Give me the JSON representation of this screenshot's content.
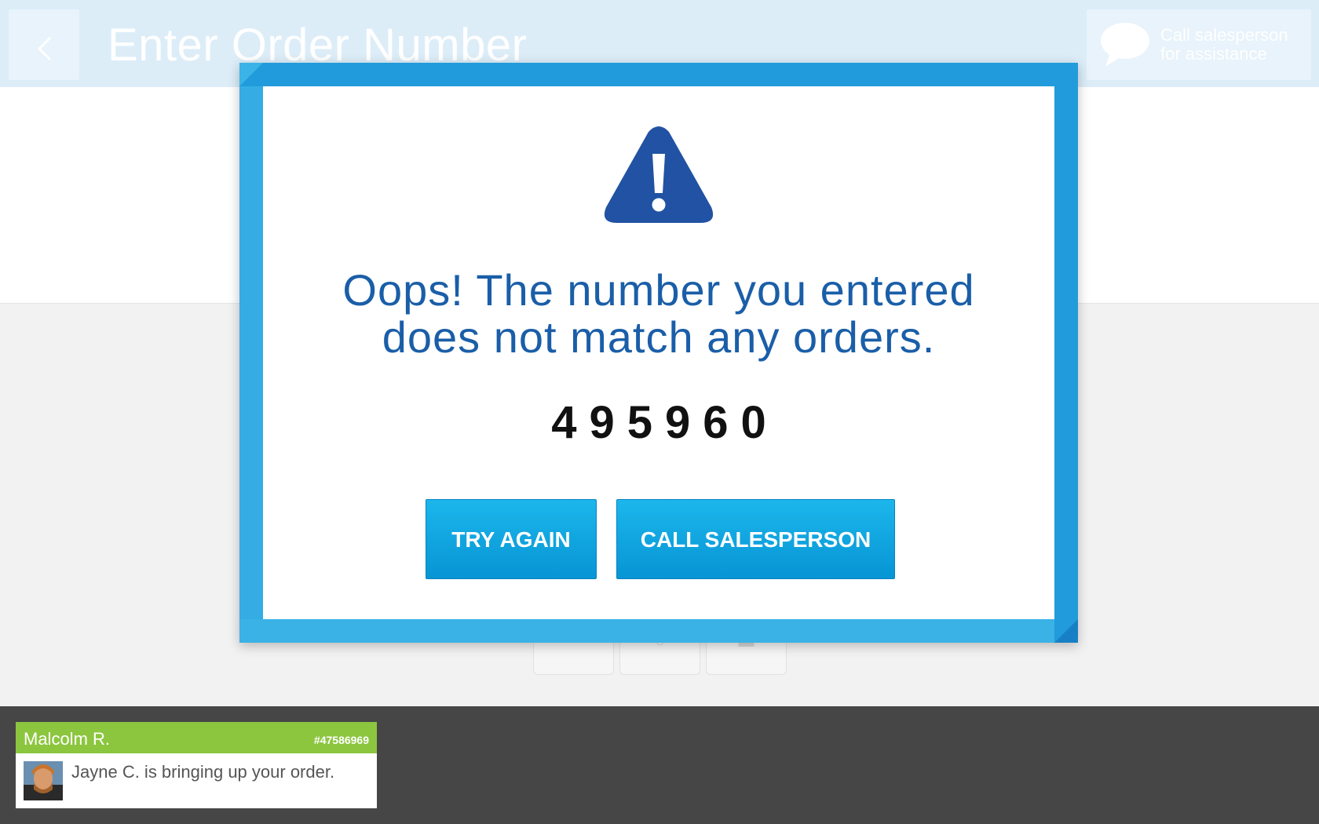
{
  "header": {
    "title": "Enter Order Number",
    "assist_line1": "Call salesperson",
    "assist_line2": "for assistance"
  },
  "modal": {
    "message_line1": "Oops! The number you entered",
    "message_line2": "does not match any orders.",
    "order_number": "495960",
    "try_again_label": "TRY AGAIN",
    "call_label": "CALL SALESPERSON"
  },
  "notification": {
    "name": "Malcolm R.",
    "order_id": "#47586969",
    "message": "Jayne C. is bringing up your order."
  },
  "colors": {
    "frame": "#219bdb",
    "message_text": "#1a5ea8",
    "warning_icon": "#2152a3",
    "button": "#0795d4",
    "notify_header": "#8cc63f",
    "bottom_bar": "#464646"
  },
  "icons": [
    "back-arrow-icon",
    "speech-bubble-icon",
    "warning-icon"
  ]
}
